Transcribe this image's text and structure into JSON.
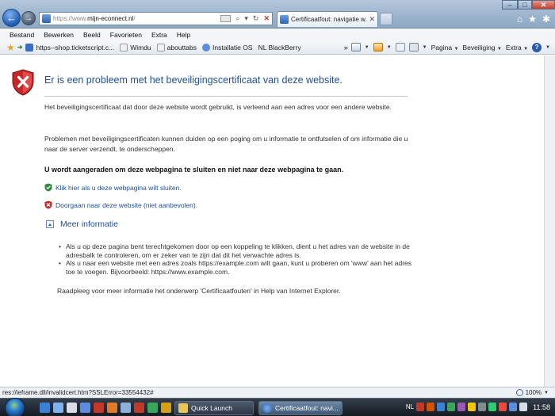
{
  "browser": {
    "url_prefix": "https://www.",
    "url_domain": "mijn-econnect.nl",
    "url_suffix": "/",
    "tab_title": "Certificaatfout: navigatie w...",
    "tab_close": "✕"
  },
  "menu": [
    "Bestand",
    "Bewerken",
    "Beeld",
    "Favorieten",
    "Extra",
    "Help"
  ],
  "favorites": {
    "items": [
      {
        "label": "https--shop.ticketscript.c...",
        "icon": "ticketscript-icon"
      },
      {
        "label": "Wimdu",
        "icon": "page-icon"
      },
      {
        "label": "abouttabs",
        "icon": "page-icon"
      },
      {
        "label": "Installatie OS",
        "icon": "w-icon"
      },
      {
        "label": "NL BlackBerry",
        "icon": "page-icon"
      }
    ],
    "more": "»"
  },
  "commandbar": {
    "page_label": "Pagina",
    "safety_label": "Beveiliging",
    "tools_label": "Extra"
  },
  "content": {
    "heading": "Er is een probleem met het beveiligingscertificaat van deze website.",
    "para1": "Het beveiligingscertificaat dat door deze website wordt gebruikt, is verleend aan een adres voor een andere website.",
    "para2": "Problemen met beveiligingscertificaten kunnen duiden op een poging om u informatie te ontfutselen of om informatie die u naar de server verzendt, te onderscheppen.",
    "warning": "U wordt aangeraden om deze webpagina te sluiten en niet naar deze webpagina te gaan.",
    "link_close": "Klik hier als u deze webpagina wilt sluiten.",
    "link_continue": "Doorgaan naar deze website (niet aanbevolen).",
    "more_info": "Meer informatie",
    "bullets": [
      "Als u op deze pagina bent terechtgekomen door op een koppeling te klikken, dient u het adres van de website in de adresbalk te controleren, om er zeker van te zijn dat dit het verwachte adres is.",
      "Als u naar een website met een adres zoals https://example.com wilt gaan, kunt u proberen om 'www' aan het adres toe te voegen. Bijvoorbeeld: https://www.example.com."
    ],
    "advice": "Raadpleeg voor meer informatie het onderwerp 'Certificaatfouten' in Help van Internet Explorer."
  },
  "status": {
    "text": "res://ieframe.dll/invalidcert.htm?SSLError=33554432#",
    "zoom": "100%"
  },
  "taskbar": {
    "quick_launch": "Quick Launch",
    "ie_window": "Certificaatfout: navi...",
    "lang": "NL",
    "time": "11:58"
  },
  "colors": {
    "heading": "#1f4f9a",
    "link": "#1f4f9a",
    "shield_red": "#c62828",
    "ok_green": "#2e8b3d"
  }
}
